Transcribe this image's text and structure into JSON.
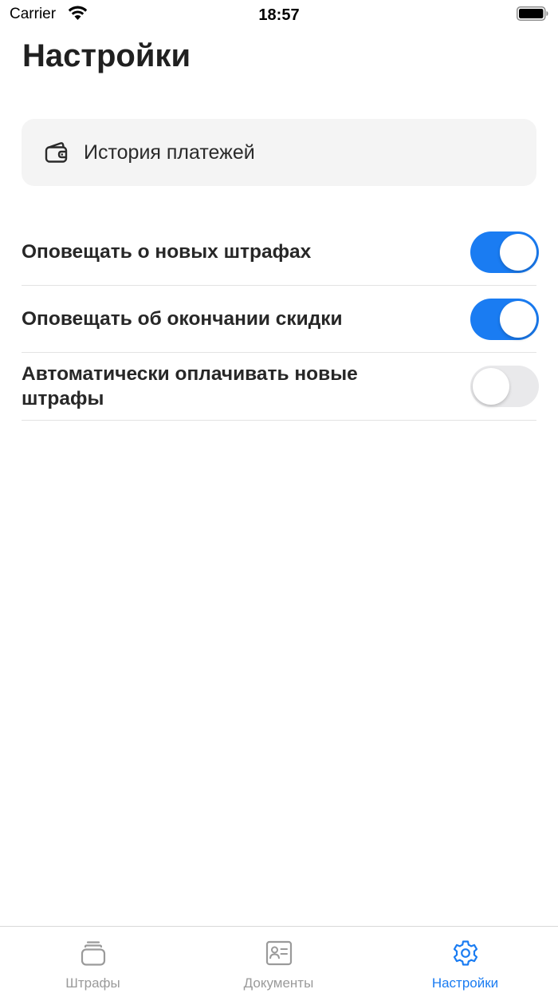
{
  "status_bar": {
    "carrier": "Carrier",
    "time": "18:57"
  },
  "page": {
    "title": "Настройки"
  },
  "history": {
    "label": "История платежей",
    "icon": "wallet-icon"
  },
  "settings": [
    {
      "label": "Оповещать о новых штрафах",
      "enabled": true
    },
    {
      "label": "Оповещать об окончании скидки",
      "enabled": true
    },
    {
      "label": "Автоматически оплачивать новые штрафы",
      "enabled": false
    }
  ],
  "tabs": [
    {
      "label": "Штрафы",
      "icon": "fines-stack-icon",
      "active": false
    },
    {
      "label": "Документы",
      "icon": "id-card-icon",
      "active": false
    },
    {
      "label": "Настройки",
      "icon": "gear-icon",
      "active": true
    }
  ],
  "colors": {
    "accent": "#1a7cf2",
    "toggle_off": "#e9e9eb",
    "card_background": "#f4f4f4",
    "inactive_tab": "#9a9a9a"
  }
}
